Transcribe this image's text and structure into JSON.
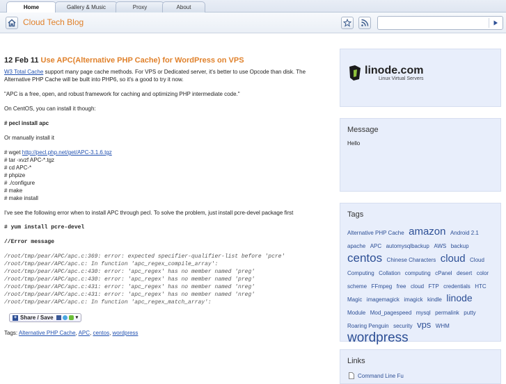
{
  "tabs": [
    "Home",
    "Gallery & Music",
    "Proxy",
    "About"
  ],
  "header": {
    "title": "Cloud Tech Blog",
    "search_placeholder": ""
  },
  "post": {
    "date": "12 Feb 11",
    "title": "Use APC(Alternative PHP Cache) for WordPress on VPS",
    "intro_link": "W3 Total Cache",
    "intro_rest_1": " support many page cache methods. For VPS or Dedicated server, it's better to use Opcode than disk.  The",
    "intro_rest_2": "Alternative PHP Cache will be built into PHP6, so it's a good to try it now.",
    "quote": "\"APC is a free, open, and robust framework for caching and optimizing PHP intermediate code.\"",
    "centos": "On CentOS, you can install it though:",
    "pecl": "# pecl install apc",
    "manual": "Or manually install it",
    "wget_prefix": "# wget ",
    "wget_link": "http://pecl.php.net/get/APC-3.1.6.tgz",
    "cmds": [
      "# tar -xvzf APC-*.tgz",
      "# cd APC-*",
      "# phpize",
      "# ./configure",
      "# make",
      "# make install"
    ],
    "error_intro": "I've see the following error when to install APC through pecl. To solve the problem, just install pcre-devel package first",
    "yum": "# yum install pcre-devel",
    "error_header": "//Error message",
    "errors": [
      "/root/tmp/pear/APC/apc.c:369: error: expected specifier-qualifier-list before 'pcre'",
      "/root/tmp/pear/APC/apc.c: In function 'apc_regex_compile_array':",
      "/root/tmp/pear/APC/apc.c:430: error: 'apc_regex' has no member named 'preg'",
      "/root/tmp/pear/APC/apc.c:430: error: 'apc_regex' has no member named 'preg'",
      "/root/tmp/pear/APC/apc.c:431: error: 'apc_regex' has no member named 'nreg'",
      "/root/tmp/pear/APC/apc.c:431: error: 'apc_regex' has no member named 'nreg'",
      "/root/tmp/pear/APC/apc.c: In function 'apc_regex_match_array':"
    ],
    "share_label": "Share / Save",
    "tags_label": "Tags:",
    "tags": [
      "Alternative PHP Cache",
      "APC",
      "centos",
      "wordpress"
    ]
  },
  "sidebar": {
    "ad_brand": "linode.com",
    "ad_tagline": "Linux Virtual Servers",
    "message_title": "Message",
    "message_text": "Hello",
    "tags_title": "Tags",
    "cloud": [
      {
        "t": "Alternative PHP Cache",
        "s": 8
      },
      {
        "t": "amazon",
        "s": 15
      },
      {
        "t": "Android 2.1",
        "s": 8
      },
      {
        "t": "apache",
        "s": 8
      },
      {
        "t": "APC",
        "s": 8
      },
      {
        "t": "automysqlbackup",
        "s": 8
      },
      {
        "t": "AWS",
        "s": 8
      },
      {
        "t": "backup",
        "s": 8
      },
      {
        "t": "centos",
        "s": 17
      },
      {
        "t": "Chinese Characters",
        "s": 8
      },
      {
        "t": "cloud",
        "s": 15
      },
      {
        "t": "Cloud Computing",
        "s": 8
      },
      {
        "t": "Collation",
        "s": 8
      },
      {
        "t": "computing",
        "s": 8
      },
      {
        "t": "cPanel",
        "s": 8
      },
      {
        "t": "desert",
        "s": 8
      },
      {
        "t": "color scheme",
        "s": 8
      },
      {
        "t": "FFmpeg",
        "s": 8
      },
      {
        "t": "free",
        "s": 8
      },
      {
        "t": "cloud",
        "s": 8
      },
      {
        "t": "FTP",
        "s": 8
      },
      {
        "t": "credentials",
        "s": 8
      },
      {
        "t": "HTC",
        "s": 8
      },
      {
        "t": "Magic",
        "s": 8
      },
      {
        "t": "imagemagick",
        "s": 8
      },
      {
        "t": "imagick",
        "s": 8
      },
      {
        "t": "kindle",
        "s": 8
      },
      {
        "t": "linode",
        "s": 14
      },
      {
        "t": "Module",
        "s": 8
      },
      {
        "t": "Mod_pagespeed",
        "s": 8
      },
      {
        "t": "mysql",
        "s": 8
      },
      {
        "t": "permalink",
        "s": 8
      },
      {
        "t": "putty",
        "s": 8
      },
      {
        "t": "Roaring Penguin",
        "s": 8
      },
      {
        "t": "security",
        "s": 8
      },
      {
        "t": "vps",
        "s": 13
      },
      {
        "t": "WHM",
        "s": 8
      },
      {
        "t": "wordpress",
        "s": 19
      }
    ],
    "links_title": "Links",
    "links": [
      "Command Line Fu"
    ]
  },
  "colors": {
    "accent": "#e0812b",
    "link": "#2050b0",
    "sidebar_bg": "#e8eefb"
  }
}
